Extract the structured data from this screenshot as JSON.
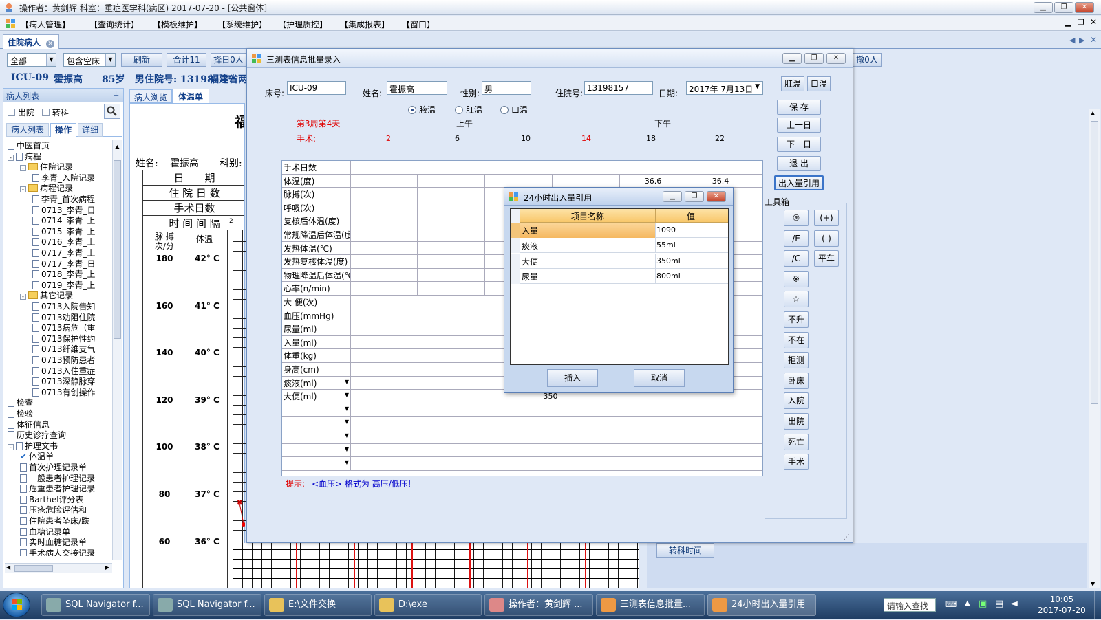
{
  "window": {
    "title": "操作者：黄剑辉  科室：重症医学科(病区)  2017-07-20 - [公共窗体]"
  },
  "menu": [
    "【病人管理】",
    "【查询统计】",
    "【模板维护】",
    "【系统维护】",
    "【护理质控】",
    "【集成报表】",
    "【窗口】"
  ],
  "doc_tab": "住院病人",
  "toolbar": {
    "filter_all": "全部",
    "filter_bed": "包含空床",
    "refresh": "刷新",
    "total": "合计11",
    "select_day": "择日0人",
    "right_count": "撤0人"
  },
  "patient": {
    "bed": "ICU-09",
    "name": "霍振高",
    "age": "85岁",
    "gender_id": "男住院号: 13198157",
    "province": "福建省两"
  },
  "left": {
    "header": "病人列表",
    "check_discharged": "出院",
    "check_transfer": "转科",
    "tabs": [
      "病人列表",
      "操作",
      "详细"
    ],
    "tree": [
      {
        "level": 0,
        "type": "doc",
        "label": "中医首页"
      },
      {
        "level": 0,
        "type": "doc",
        "label": "病程",
        "exp": "-"
      },
      {
        "level": 1,
        "type": "folder",
        "label": "住院记录",
        "exp": "-"
      },
      {
        "level": 2,
        "type": "doc",
        "label": "李青_入院记录"
      },
      {
        "level": 1,
        "type": "folder",
        "label": "病程记录",
        "exp": "-"
      },
      {
        "level": 2,
        "type": "doc",
        "label": "李青_首次病程"
      },
      {
        "level": 2,
        "type": "doc",
        "label": "0713_李青_日"
      },
      {
        "level": 2,
        "type": "doc",
        "label": "0714_李青_上"
      },
      {
        "level": 2,
        "type": "doc",
        "label": "0715_李青_上"
      },
      {
        "level": 2,
        "type": "doc",
        "label": "0716_李青_上"
      },
      {
        "level": 2,
        "type": "doc",
        "label": "0717_李青_上"
      },
      {
        "level": 2,
        "type": "doc",
        "label": "0717_李青_日"
      },
      {
        "level": 2,
        "type": "doc",
        "label": "0718_李青_上"
      },
      {
        "level": 2,
        "type": "doc",
        "label": "0719_李青_上"
      },
      {
        "level": 1,
        "type": "folder",
        "label": "其它记录",
        "exp": "-"
      },
      {
        "level": 2,
        "type": "doc",
        "label": "0713入院告知"
      },
      {
        "level": 2,
        "type": "doc",
        "label": "0713劝阻住院"
      },
      {
        "level": 2,
        "type": "doc",
        "label": "0713病危（重"
      },
      {
        "level": 2,
        "type": "doc",
        "label": "0713保护性约"
      },
      {
        "level": 2,
        "type": "doc",
        "label": "0713纤维支气"
      },
      {
        "level": 2,
        "type": "doc",
        "label": "0713预防患者"
      },
      {
        "level": 2,
        "type": "doc",
        "label": "0713入住重症"
      },
      {
        "level": 2,
        "type": "doc",
        "label": "0713深静脉穿"
      },
      {
        "level": 2,
        "type": "doc",
        "label": "0713有创操作"
      },
      {
        "level": 0,
        "type": "doc",
        "label": "检查"
      },
      {
        "level": 0,
        "type": "doc",
        "label": "检验"
      },
      {
        "level": 0,
        "type": "doc",
        "label": "体征信息"
      },
      {
        "level": 0,
        "type": "doc",
        "label": "历史诊疗查询"
      },
      {
        "level": 0,
        "type": "doc",
        "label": "护理文书",
        "exp": "-"
      },
      {
        "level": 1,
        "type": "check",
        "label": "体温单"
      },
      {
        "level": 1,
        "type": "doc",
        "label": "首次护理记录单"
      },
      {
        "level": 1,
        "type": "doc",
        "label": "一般患者护理记录"
      },
      {
        "level": 1,
        "type": "doc",
        "label": "危重患者护理记录"
      },
      {
        "level": 1,
        "type": "doc",
        "label": "Barthel评分表"
      },
      {
        "level": 1,
        "type": "doc",
        "label": "压疮危险评估和"
      },
      {
        "level": 1,
        "type": "doc",
        "label": "住院患者坠床/跌"
      },
      {
        "level": 1,
        "type": "doc",
        "label": "血糖记录单"
      },
      {
        "level": 1,
        "type": "doc",
        "label": "实时血糖记录单"
      },
      {
        "level": 1,
        "type": "doc",
        "label": "手术病人交接记录"
      }
    ]
  },
  "sheet": {
    "tabs": [
      "病人浏览",
      "体温单"
    ],
    "title_char": "福",
    "name_label": "姓名:",
    "name_value": "霍振高",
    "dept_label": "科别:",
    "rows": [
      "日　　期",
      "住 院 日 数",
      "手术日数",
      "时 间 间 隔"
    ],
    "pulse_header": "脉 搏\n次/分",
    "temp_header": "体温",
    "interval_first": "2",
    "scale": [
      {
        "pulse": "180",
        "temp": "42° C"
      },
      {
        "pulse": "160",
        "temp": "41° C"
      },
      {
        "pulse": "140",
        "temp": "40° C"
      },
      {
        "pulse": "120",
        "temp": "39° C"
      },
      {
        "pulse": "100",
        "temp": "38° C"
      },
      {
        "pulse": "80",
        "temp": "37° C"
      },
      {
        "pulse": "60",
        "temp": "36° C"
      }
    ],
    "transfer_time": "转科时间"
  },
  "dialog": {
    "title": "三测表信息批量录入",
    "bed_label": "床号:",
    "bed_value": "ICU-09",
    "name_label": "姓名:",
    "name_value": "霍振高",
    "gender_label": "性别:",
    "gender_value": "男",
    "id_label": "住院号:",
    "id_value": "13198157",
    "date_label": "日期:",
    "date_value": "2017年 7月13日",
    "btn_anal": "肛温",
    "btn_oral": "口温",
    "radios": [
      "腋温",
      "肛温",
      "口温"
    ],
    "week_label": "第3周第4天",
    "surgery_label": "手术:",
    "am": "上午",
    "pm": "下午",
    "hours": [
      "2",
      "6",
      "10",
      "14",
      "18",
      "22"
    ],
    "rows": [
      "手术日数",
      "体温(度)",
      "脉搏(次)",
      "呼吸(次)",
      "复核后体温(度)",
      "常规降温后体温(度)",
      "发热体温(℃)",
      "发热复核体温(度)",
      "物理降温后体温(℃)",
      "心率(n/min)",
      "大 便(次)",
      "血压(mmHg)",
      "尿量(ml)",
      "入量(ml)",
      "体重(kg)",
      "身高(cm)"
    ],
    "combo_rows": [
      "痰液(ml)",
      "大便(ml)",
      "",
      "",
      "",
      "",
      ""
    ],
    "temp_values": [
      "36.6",
      "36.4"
    ],
    "stool_ml_value": "350",
    "hint_prefix": "提示:",
    "hint_body": "<血压> 格式为 高压/低压!",
    "side_buttons": [
      "保 存",
      "上一日",
      "下一日",
      "退 出",
      "出入量引用"
    ],
    "toolbox_label": "工具箱",
    "tools_left": [
      "®",
      "/E",
      "/C",
      "※",
      "☆",
      "不升",
      "不在",
      "拒测",
      "卧床",
      "入院",
      "出院",
      "死亡",
      "手术"
    ],
    "tools_right": [
      "(+)",
      "(-)",
      "平车"
    ]
  },
  "io_dialog": {
    "title": "24小时出入量引用",
    "col_name": "项目名称",
    "col_value": "值",
    "rows": [
      {
        "name": "入量",
        "value": "1090"
      },
      {
        "name": "痰液",
        "value": "55ml"
      },
      {
        "name": "大便",
        "value": "350ml"
      },
      {
        "name": "尿量",
        "value": "800ml"
      }
    ],
    "insert": "插入",
    "cancel": "取消"
  },
  "taskbar": {
    "items": [
      "SQL Navigator f...",
      "SQL Navigator f...",
      "E:\\文件交换",
      "D:\\exe",
      "操作者：黄剑辉 ...",
      "三测表信息批量...",
      "24小时出入量引用"
    ],
    "search_placeholder": "请输入查找",
    "time": "10:05",
    "date": "2017-07-20"
  },
  "colors": {
    "accent": "#15428b",
    "red_text": "#e00000",
    "blue_text": "#0000cc",
    "selected_row": "#f5b860"
  }
}
